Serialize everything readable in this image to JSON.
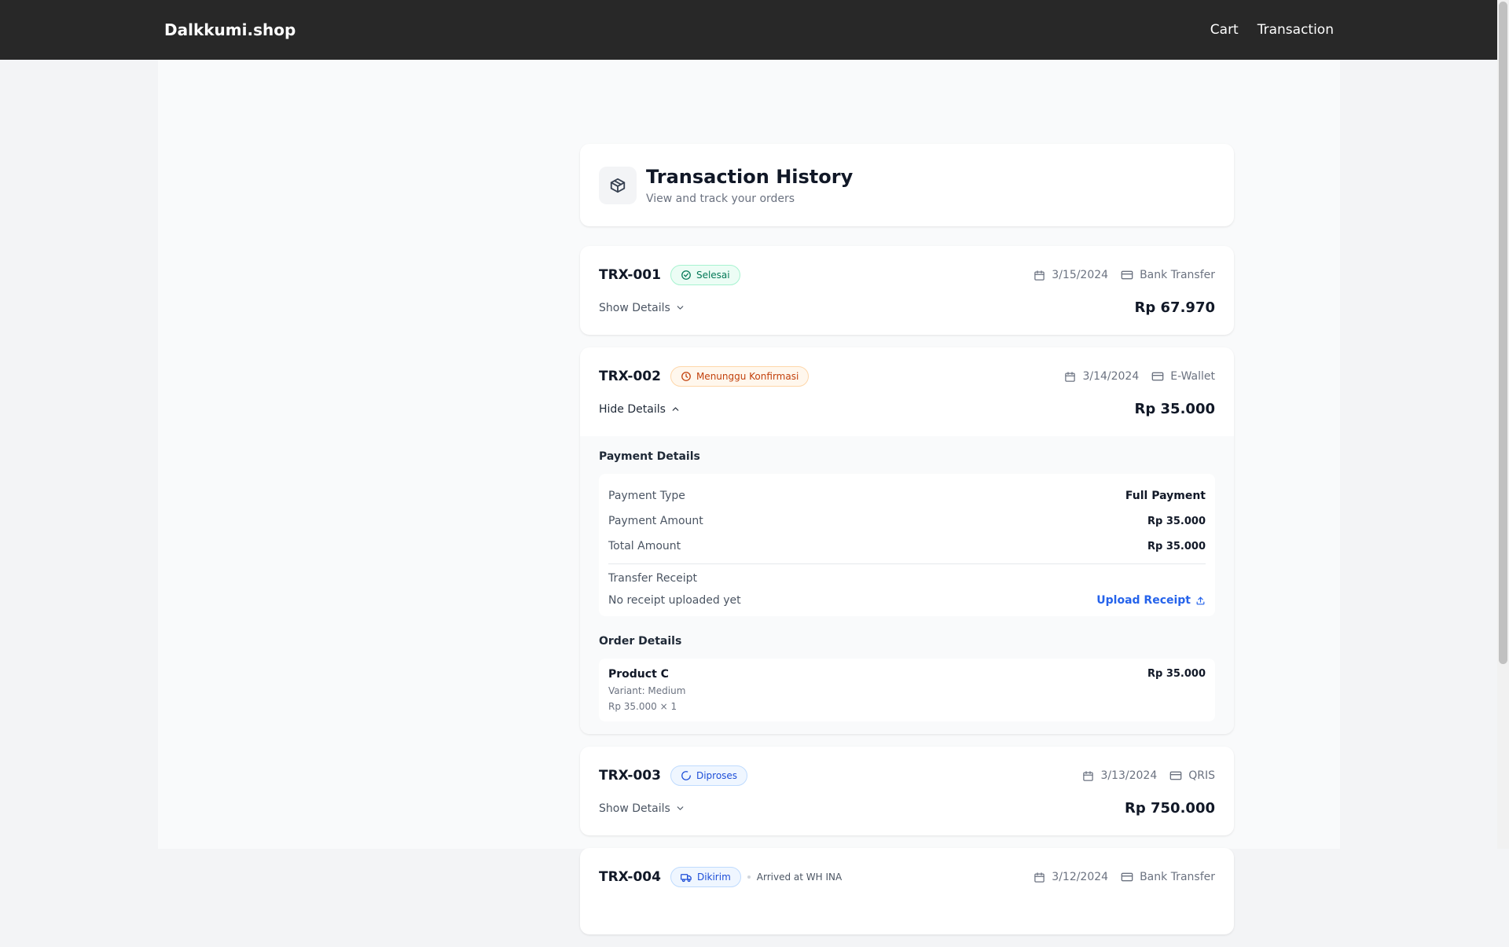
{
  "navbar": {
    "brand": "Dalkkumi.shop",
    "links": [
      "Cart",
      "Transaction"
    ]
  },
  "header": {
    "icon": "package-icon",
    "title": "Transaction History",
    "subtitle": "View and track your orders"
  },
  "transactions": [
    {
      "id": "TRX-001",
      "status": "Selesai",
      "status_icon": "check-circle-icon",
      "date": "3/15/2024",
      "method": "Bank Transfer",
      "toggle": "Show Details",
      "total": "Rp 67.970"
    },
    {
      "id": "TRX-002",
      "status": "Menunggu Konfirmasi",
      "status_icon": "clock-icon",
      "date": "3/14/2024",
      "method": "E-Wallet",
      "toggle": "Hide Details",
      "total": "Rp 35.000",
      "payment": {
        "title": "Payment Details",
        "rows": [
          {
            "label": "Payment Type",
            "value": "Full Payment"
          },
          {
            "label": "Payment Amount",
            "value": "Rp 35.000"
          },
          {
            "label": "Total Amount",
            "value": "Rp 35.000"
          }
        ],
        "receipt_label": "Transfer Receipt",
        "receipt_status": "No receipt uploaded yet",
        "upload_label": "Upload Receipt"
      },
      "order": {
        "title": "Order Details",
        "items": [
          {
            "name": "Product C",
            "variant": "Variant: Medium",
            "qty_line": "Rp 35.000 × 1",
            "price": "Rp 35.000"
          }
        ]
      }
    },
    {
      "id": "TRX-003",
      "status": "Diproses",
      "status_icon": "loader-icon",
      "date": "3/13/2024",
      "method": "QRIS",
      "toggle": "Show Details",
      "total": "Rp 750.000"
    },
    {
      "id": "TRX-004",
      "status": "Dikirim",
      "status_icon": "truck-icon",
      "status_note": "Arrived at WH INA",
      "date": "3/12/2024",
      "method": "Bank Transfer"
    }
  ],
  "colors": {
    "navbar_bg": "#282828",
    "completed": "#047857",
    "pending": "#c2410c",
    "processing": "#1d4ed8",
    "link": "#2563eb"
  }
}
